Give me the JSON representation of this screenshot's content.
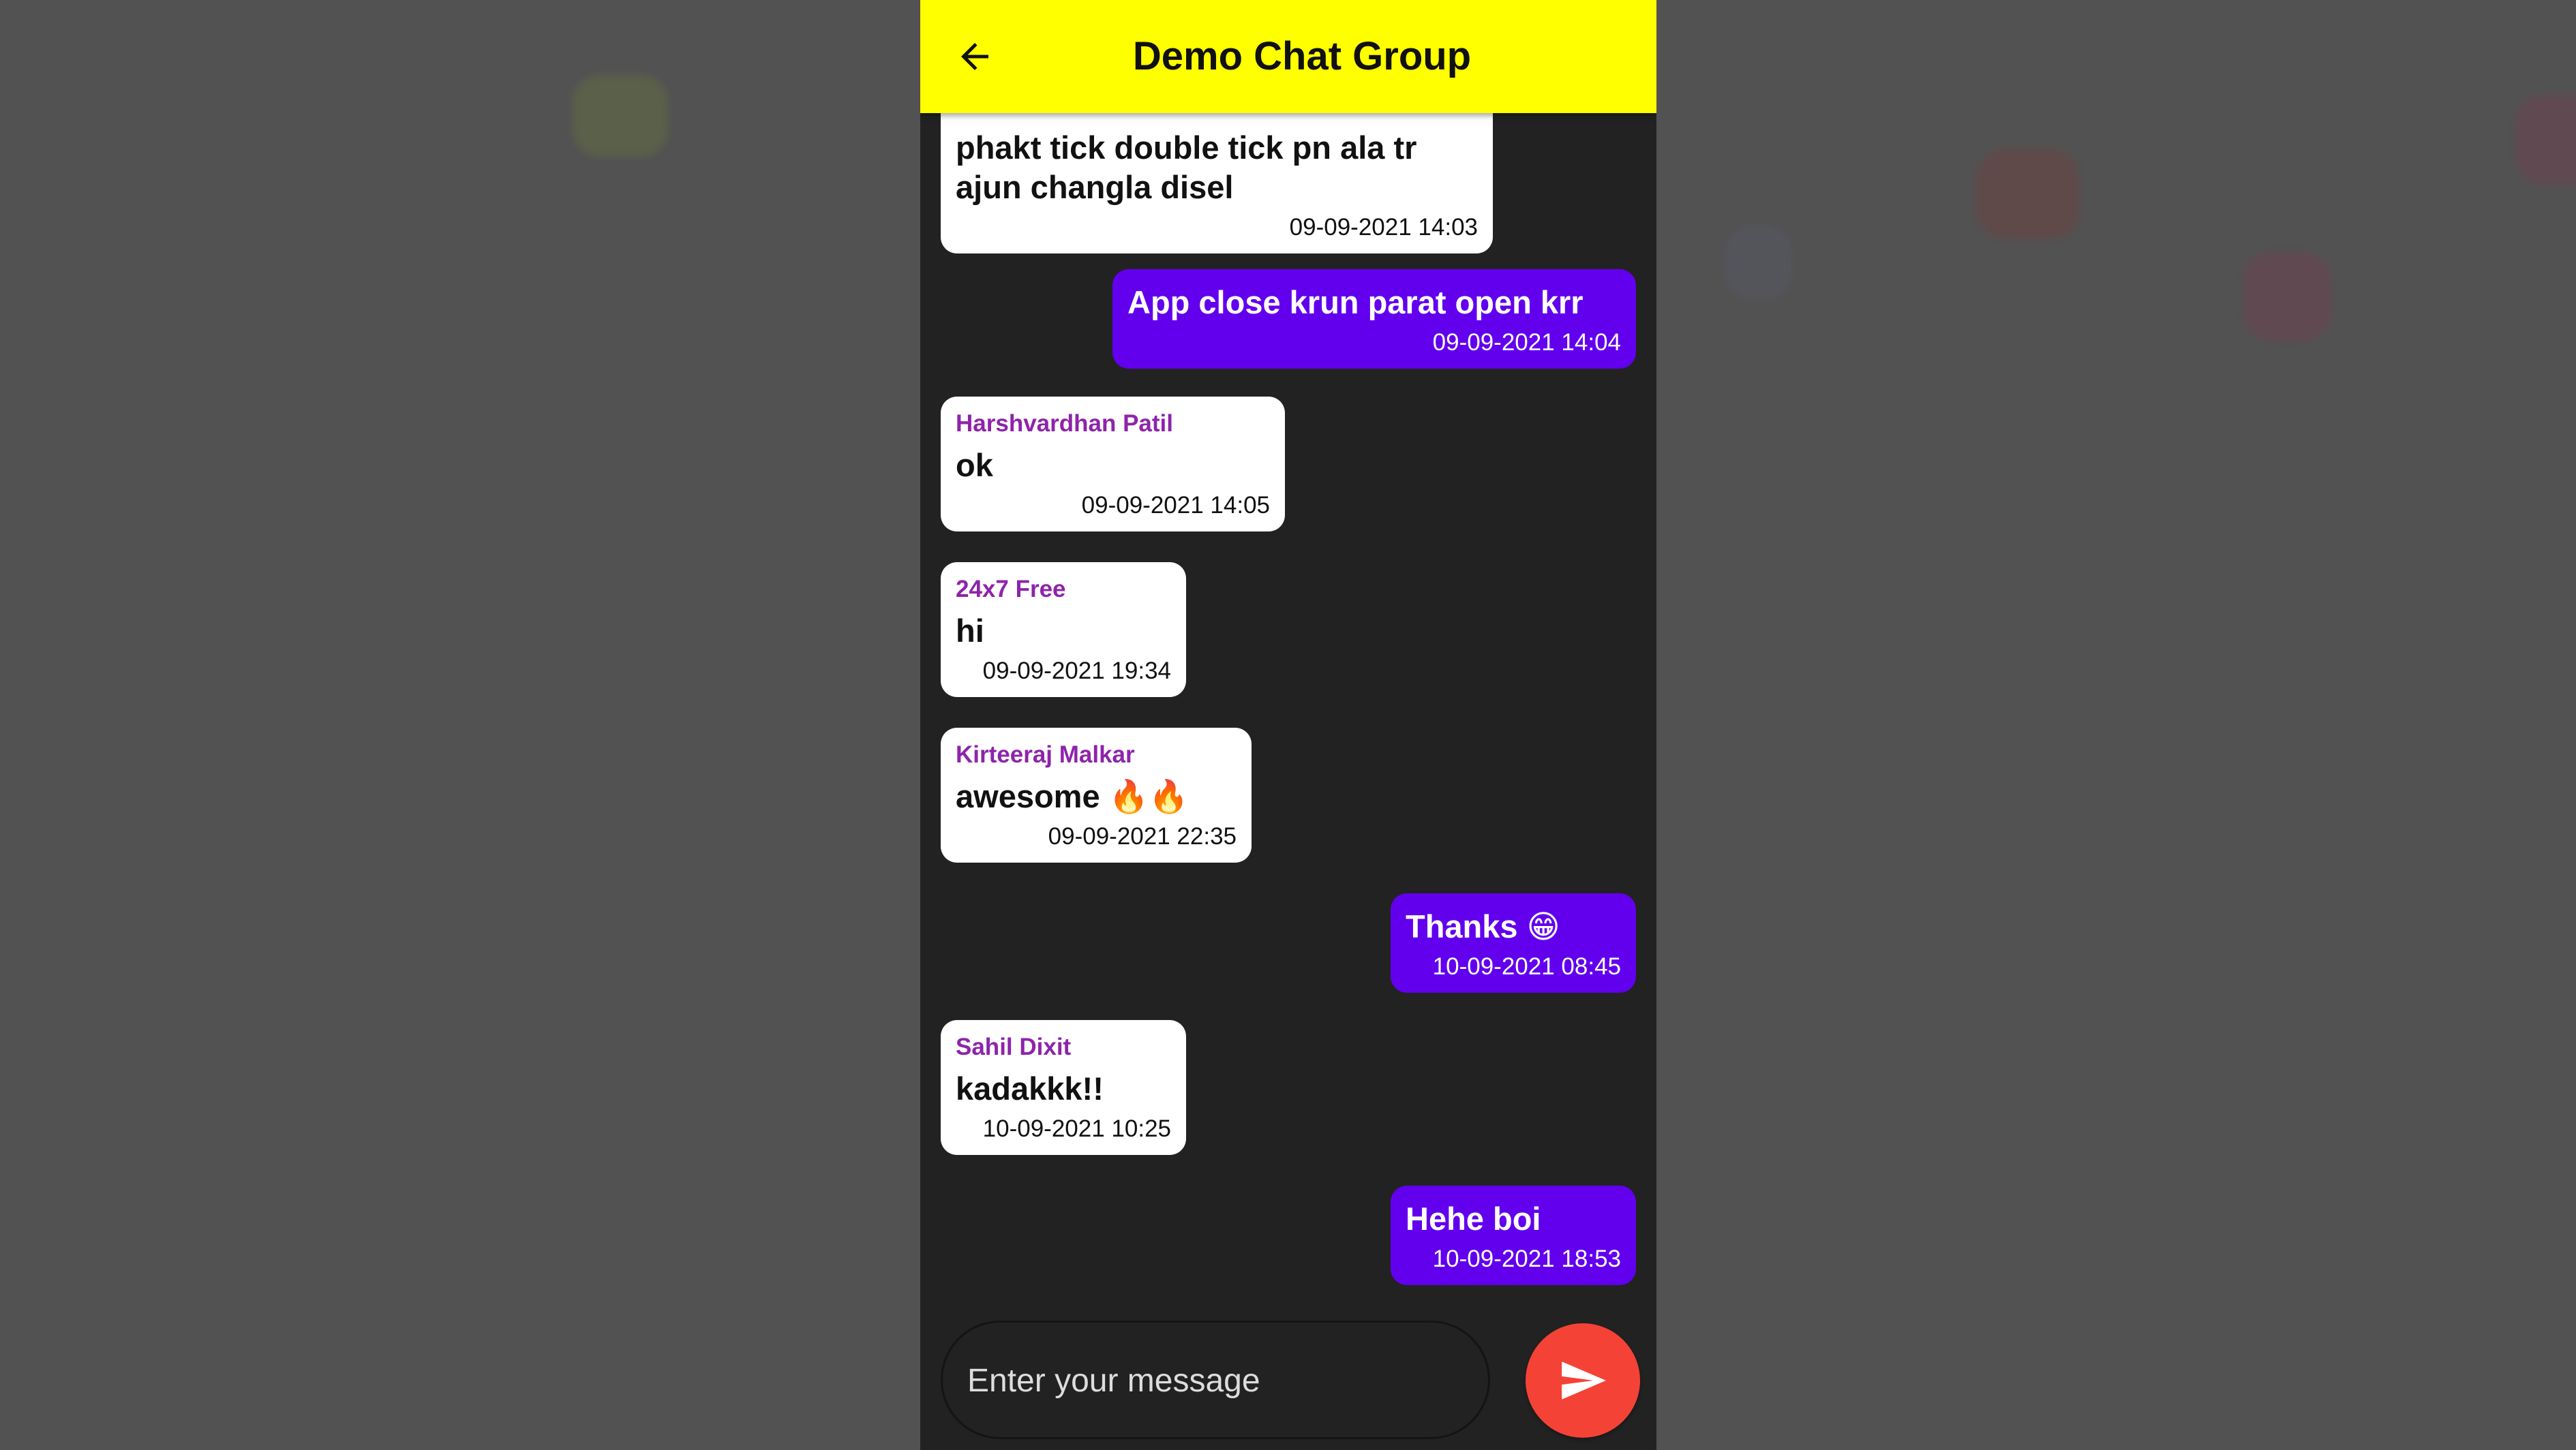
{
  "app_bar": {
    "title": "Demo Chat Group",
    "back_icon": "arrow-left-icon",
    "background_color": "#ffff00"
  },
  "messages": [
    {
      "direction": "incoming",
      "sender": "",
      "text": "phakt tick double tick pn ala tr ajun changla disel",
      "time": "09-09-2021 14:03"
    },
    {
      "direction": "outgoing",
      "text": "App close krun parat open krr",
      "time": "09-09-2021 14:04"
    },
    {
      "direction": "incoming",
      "sender": "Harshvardhan Patil",
      "text": "ok",
      "time": "09-09-2021 14:05"
    },
    {
      "direction": "incoming",
      "sender": "24x7 Free",
      "text": "hi",
      "time": "09-09-2021 19:34"
    },
    {
      "direction": "incoming",
      "sender": "Kirteeraj Malkar",
      "text": "awesome 🔥🔥",
      "time": "09-09-2021 22:35"
    },
    {
      "direction": "outgoing",
      "text": "Thanks 😁",
      "time": "10-09-2021 08:45"
    },
    {
      "direction": "incoming",
      "sender": "Sahil Dixit",
      "text": "kadakkk!!",
      "time": "10-09-2021 10:25"
    },
    {
      "direction": "outgoing",
      "text": "Hehe boi",
      "time": "10-09-2021 18:53"
    }
  ],
  "composer": {
    "placeholder": "Enter your message",
    "value": "",
    "send_icon": "send-icon",
    "send_button_color": "#f44336"
  },
  "colors": {
    "outgoing_bubble": "#6200ee",
    "incoming_bubble": "#ffffff",
    "sender_name": "#8e24aa",
    "chat_background": "#222222"
  }
}
